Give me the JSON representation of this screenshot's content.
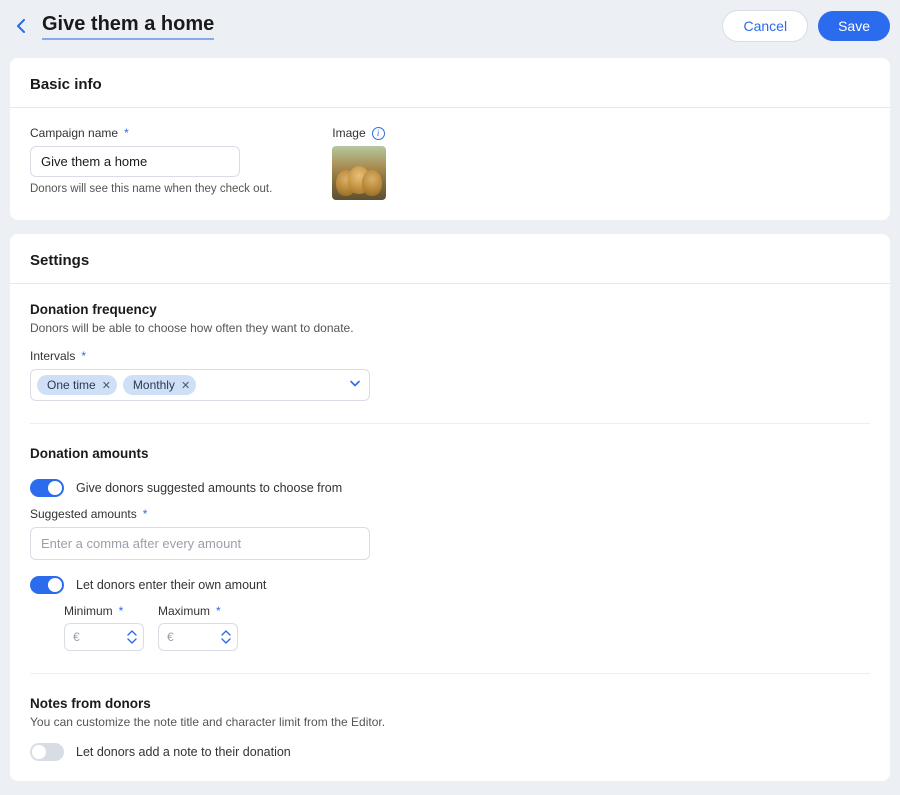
{
  "header": {
    "title": "Give them a home",
    "cancel_label": "Cancel",
    "save_label": "Save"
  },
  "basic_info": {
    "title": "Basic info",
    "campaign_name_label": "Campaign name",
    "campaign_name_value": "Give them a home",
    "campaign_name_help": "Donors will see this name when they check out.",
    "image_label": "Image"
  },
  "settings": {
    "title": "Settings",
    "frequency_title": "Donation frequency",
    "frequency_desc": "Donors will be able to choose how often they want to donate.",
    "intervals_label": "Intervals",
    "intervals": [
      {
        "label": "One time"
      },
      {
        "label": "Monthly"
      }
    ],
    "amounts_title": "Donation amounts",
    "suggested_toggle_label": "Give donors suggested amounts to choose from",
    "suggested_toggle_on": true,
    "suggested_amounts_label": "Suggested amounts",
    "suggested_amounts_placeholder": "Enter a comma after every amount",
    "own_amount_toggle_label": "Let donors enter their own amount",
    "own_amount_toggle_on": true,
    "min_label": "Minimum",
    "max_label": "Maximum",
    "currency_symbol": "€",
    "notes_title": "Notes from donors",
    "notes_desc": "You can customize the note title and character limit from the Editor.",
    "notes_toggle_label": "Let donors add a note to their donation",
    "notes_toggle_on": false
  }
}
